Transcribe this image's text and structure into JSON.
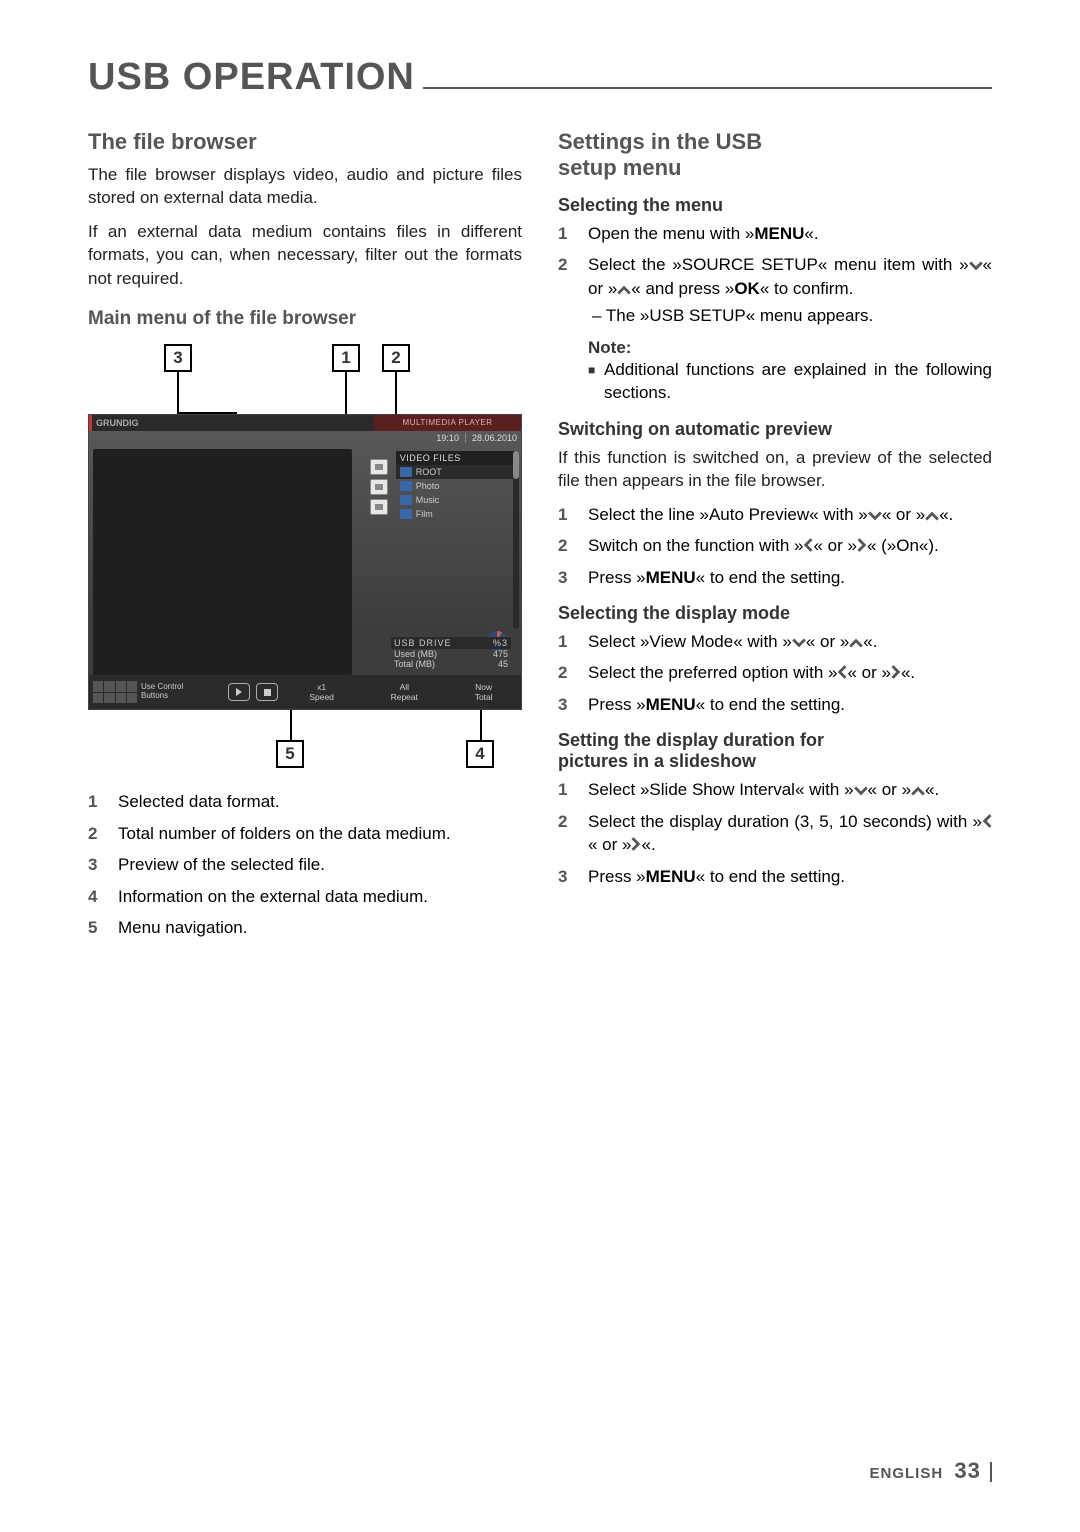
{
  "page_title": "USB OPERATION",
  "left": {
    "h2": "The file browser",
    "p1": "The file browser displays video, audio and picture files stored on external data media.",
    "p2": "If an external data medium contains files in different formats, you can, when necessary, filter out the formats not required.",
    "h3": "Main menu of the file browser",
    "legend": [
      "Selected data format.",
      "Total number of folders on the data medium.",
      "Preview of the selected file.",
      "Information on the external data medium.",
      "Menu navigation."
    ]
  },
  "diagram": {
    "callouts": {
      "c1": "1",
      "c2": "2",
      "c3": "3",
      "c4": "4",
      "c5": "5"
    },
    "brand": "GRUNDIG",
    "brand_label": "MULTIMEDIA PLAYER",
    "time": "19:10",
    "date": "28.06.2010",
    "file_header": "VIDEO FILES",
    "rows": [
      "ROOT",
      "Photo",
      "Music",
      "Film"
    ],
    "drive_title": "USB DRIVE",
    "drive_pct": "%3",
    "used_label": "Used (MB)",
    "used_val": "475",
    "total_label": "Total (MB)",
    "total_val": "45",
    "use_control": "Use Control",
    "buttons": "Buttons",
    "speed_val": "x1",
    "speed_lbl": "Speed",
    "repeat_val": "All",
    "repeat_lbl": "Repeat",
    "now_val": "Now",
    "now_lbl": "Total"
  },
  "right": {
    "h2a": "Settings in the USB",
    "h2b": "setup menu",
    "sec1_h": "Selecting the menu",
    "sec1_s1_a": "Open the menu with »",
    "sec1_s1_b": "MENU",
    "sec1_s1_c": "«.",
    "sec1_s2_a": "Select the »SOURCE SETUP« menu item with »",
    "sec1_s2_b": "« or »",
    "sec1_s2_c": "« and press »",
    "sec1_s2_d": "OK",
    "sec1_s2_e": "« to confirm.",
    "sec1_s2_sub": "– The »USB SETUP« menu appears.",
    "note_hd": "Note:",
    "note_body": "Additional functions are explained in the following sections.",
    "sec2_h": "Switching on automatic preview",
    "sec2_p": "If this function is switched on, a preview of the selected file then appears in the file browser.",
    "sec2_s1_a": "Select the line »Auto Preview« with »",
    "sec2_s1_b": "« or »",
    "sec2_s1_c": "«.",
    "sec2_s2_a": "Switch on the function with »",
    "sec2_s2_b": "« or »",
    "sec2_s2_c": "« (»On«).",
    "sec2_s3_a": "Press »",
    "sec2_s3_b": "MENU",
    "sec2_s3_c": "« to end the setting.",
    "sec3_h": "Selecting the display mode",
    "sec3_s1_a": "Select »View Mode« with »",
    "sec3_s1_b": "« or »",
    "sec3_s1_c": "«.",
    "sec3_s2_a": "Select the preferred option with »",
    "sec3_s2_b": "« or »",
    "sec3_s2_c": "«.",
    "sec3_s3_a": "Press »",
    "sec3_s3_b": "MENU",
    "sec3_s3_c": "« to end the setting.",
    "sec4_h1": "Setting the display duration for",
    "sec4_h2": "pictures in a slideshow",
    "sec4_s1_a": "Select »Slide Show Interval« with »",
    "sec4_s1_b": "« or »",
    "sec4_s1_c": "«.",
    "sec4_s2_a": "Select the display duration (3, 5, 10 seconds) with »",
    "sec4_s2_b": "« or »",
    "sec4_s2_c": "«.",
    "sec4_s3_a": "Press »",
    "sec4_s3_b": "MENU",
    "sec4_s3_c": "« to end the setting."
  },
  "footer": {
    "lang": "ENGLISH",
    "page": "33"
  },
  "nums": {
    "n1": "1",
    "n2": "2",
    "n3": "3",
    "n4": "4",
    "n5": "5"
  }
}
